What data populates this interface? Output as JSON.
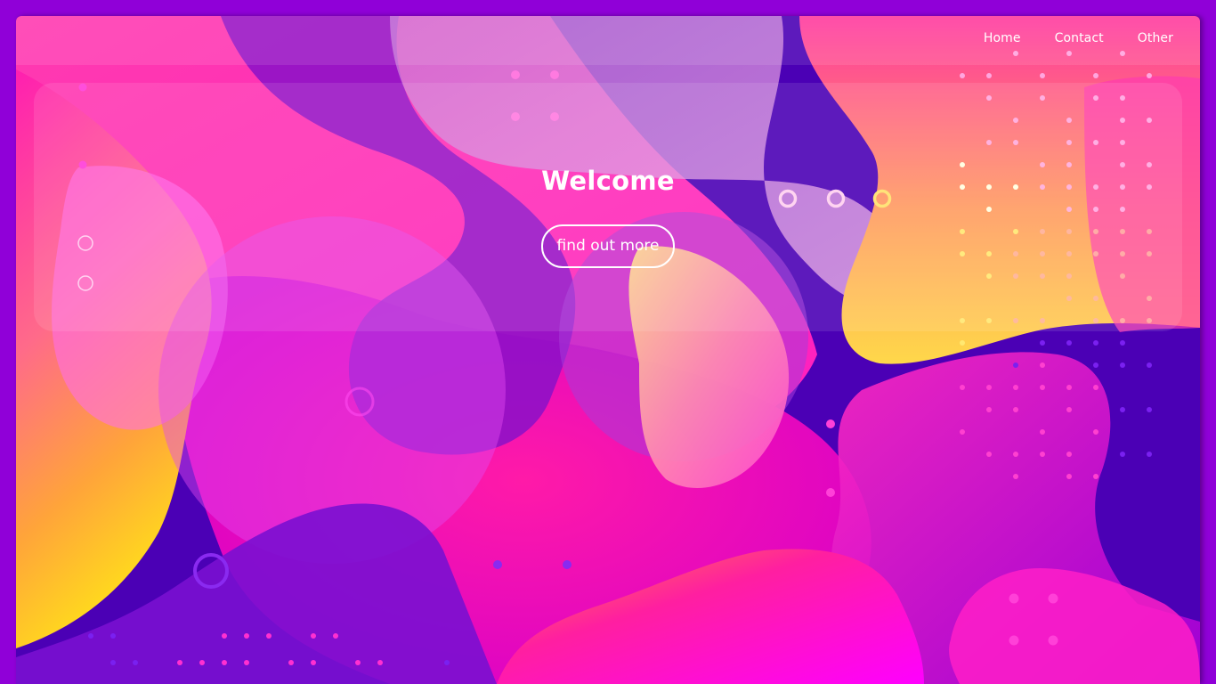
{
  "nav": {
    "items": [
      {
        "label": "Home"
      },
      {
        "label": "Contact"
      },
      {
        "label": "Other"
      }
    ]
  },
  "hero": {
    "title": "Welcome",
    "button_label": "find out more"
  },
  "colors": {
    "page_bg": "#9000d8",
    "deep_purple": "#4b00b5",
    "magenta": "#ff1fb4",
    "pink": "#ff6fe8",
    "orange": "#ffa43a",
    "yellow": "#ffe04a",
    "white": "#ffffff"
  }
}
